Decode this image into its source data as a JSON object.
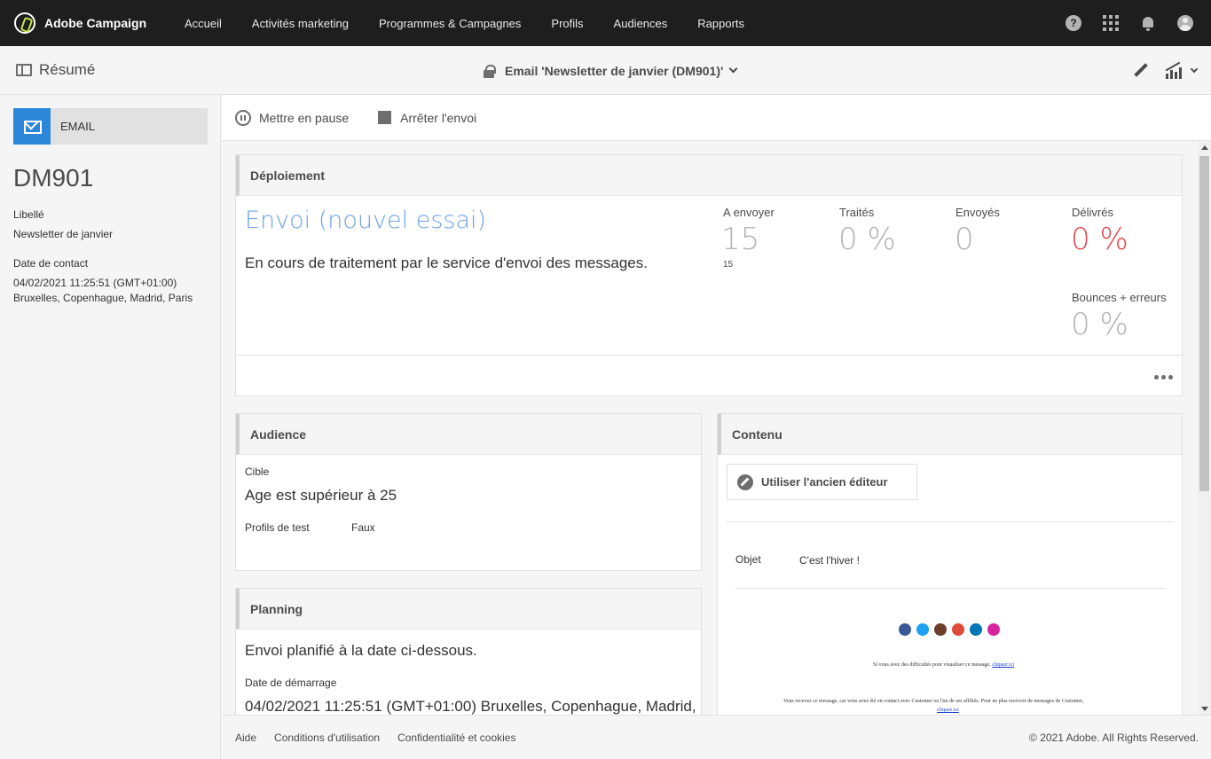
{
  "app": {
    "name": "Adobe Campaign"
  },
  "nav": [
    "Accueil",
    "Activités marketing",
    "Programmes & Campagnes",
    "Profils",
    "Audiences",
    "Rapports"
  ],
  "topIcons": {
    "help": "?"
  },
  "subbar": {
    "summary": "Résumé",
    "title": "Email 'Newsletter de janvier (DM901)'"
  },
  "sidebar": {
    "channel": "EMAIL",
    "id": "DM901",
    "libelle_label": "Libellé",
    "libelle_value": "Newsletter de janvier",
    "date_label": "Date de contact",
    "date_value": "04/02/2021 11:25:51 (GMT+01:00)",
    "timezone": "Bruxelles, Copenhague, Madrid, Paris"
  },
  "actions": {
    "pause": "Mettre en pause",
    "stop": "Arrêter l'envoi"
  },
  "deployment": {
    "heading": "Déploiement",
    "title": "Envoi (nouvel essai)",
    "status": "En cours de traitement par le service d'envoi des messages.",
    "kpis": {
      "to_send_label": "A envoyer",
      "to_send_value": "15",
      "to_send_sub": "15",
      "processed_label": "Traités",
      "processed_value": "0 %",
      "sent_label": "Envoyés",
      "sent_value": "0",
      "delivered_label": "Délivrés",
      "delivered_value": "0 %",
      "bounces_label": "Bounces + erreurs",
      "bounces_value": "0 %"
    }
  },
  "audience": {
    "heading": "Audience",
    "target_label": "Cible",
    "target_value": "Age est supérieur à 25",
    "test_profiles_label": "Profils de test",
    "test_profiles_value": "Faux"
  },
  "planning": {
    "heading": "Planning",
    "text": "Envoi planifié à la date ci-dessous.",
    "start_label": "Date de démarrage",
    "start_value": "04/02/2021 11:25:51 (GMT+01:00) Bruxelles, Copenhague, Madrid,"
  },
  "content": {
    "heading": "Contenu",
    "old_editor": "Utiliser l'ancien éditeur",
    "subject_label": "Objet",
    "subject_value": "C'est l'hiver !",
    "preview_line1": "Si vous avez des difficultés pour visualiser ce message,",
    "preview_link1": "cliquez ici",
    "preview_line2": "Vous recevez ce message, car vous avez été en contact avec Customer ou l'un de ses affiliés. Pour ne plus recevoir de messages de Customer,",
    "preview_link2": "cliquez ici",
    "social_colors": [
      "#3b5998",
      "#1da1f2",
      "#6b3f2b",
      "#dd4b39",
      "#0077b5",
      "#d6249f"
    ]
  },
  "footer": {
    "links": [
      "Aide",
      "Conditions d'utilisation",
      "Confidentialité et cookies"
    ],
    "copyright": "© 2021 Adobe. All Rights Reserved."
  }
}
